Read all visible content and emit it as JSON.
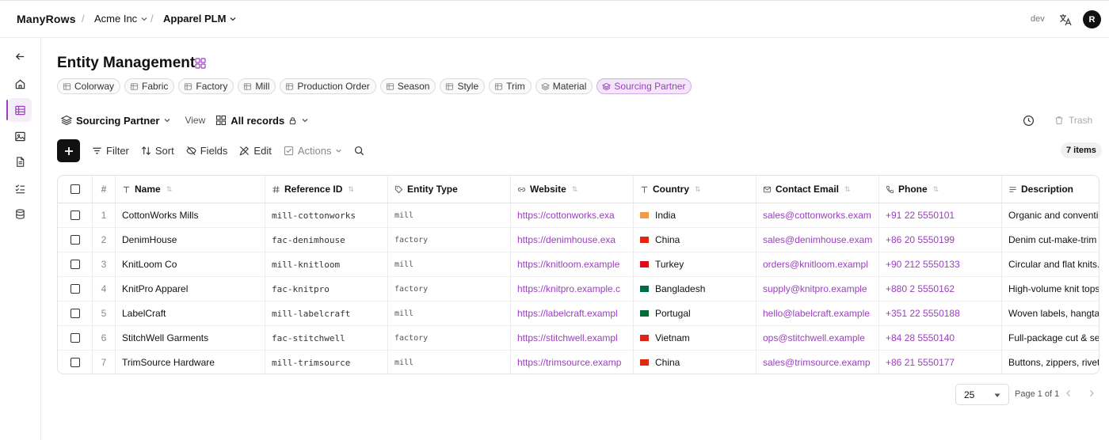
{
  "topbar": {
    "brand": "ManyRows",
    "breadcrumbs": [
      {
        "label": "Acme Inc",
        "bold": false
      },
      {
        "label": "Apparel PLM",
        "bold": true
      }
    ],
    "env": "dev",
    "avatar": "R"
  },
  "page": {
    "title": "Entity Management",
    "entity_tabs": [
      "Colorway",
      "Fabric",
      "Factory",
      "Mill",
      "Production Order",
      "Season",
      "Style",
      "Trim",
      "Material",
      "Sourcing Partner"
    ],
    "active_tab": "Sourcing Partner"
  },
  "viewbar": {
    "entity": "Sourcing Partner",
    "view_label": "View",
    "view_name": "All records",
    "trash": "Trash"
  },
  "toolbar": {
    "filter": "Filter",
    "sort": "Sort",
    "fields": "Fields",
    "edit": "Edit",
    "actions": "Actions",
    "count": "7 items"
  },
  "table": {
    "headers": {
      "num": "#",
      "name": "Name",
      "ref": "Reference ID",
      "type": "Entity Type",
      "web": "Website",
      "country": "Country",
      "email": "Contact Email",
      "phone": "Phone",
      "desc": "Description"
    },
    "rows": [
      {
        "n": "1",
        "name": "CottonWorks Mills",
        "ref": "mill-cottonworks",
        "type": "mill",
        "web": "https://cottonworks.exa",
        "country": "India",
        "flag": "in",
        "email": "sales@cottonworks.exam",
        "phone": "+91 22 5550101",
        "desc": "Organic and conventio"
      },
      {
        "n": "2",
        "name": "DenimHouse",
        "ref": "fac-denimhouse",
        "type": "factory",
        "web": "https://denimhouse.exa",
        "country": "China",
        "flag": "cn",
        "email": "sales@denimhouse.exam",
        "phone": "+86 20 5550199",
        "desc": "Denim cut-make-trim a"
      },
      {
        "n": "3",
        "name": "KnitLoom Co",
        "ref": "mill-knitloom",
        "type": "mill",
        "web": "https://knitloom.example",
        "country": "Turkey",
        "flag": "tr",
        "email": "orders@knitloom.exampl",
        "phone": "+90 212 5550133",
        "desc": "Circular and flat knits."
      },
      {
        "n": "4",
        "name": "KnitPro Apparel",
        "ref": "fac-knitpro",
        "type": "factory",
        "web": "https://knitpro.example.c",
        "country": "Bangladesh",
        "flag": "bd",
        "email": "supply@knitpro.example",
        "phone": "+880 2 5550162",
        "desc": "High-volume knit tops"
      },
      {
        "n": "5",
        "name": "LabelCraft",
        "ref": "mill-labelcraft",
        "type": "mill",
        "web": "https://labelcraft.exampl",
        "country": "Portugal",
        "flag": "pt",
        "email": "hello@labelcraft.example",
        "phone": "+351 22 5550188",
        "desc": "Woven labels, hangtag"
      },
      {
        "n": "6",
        "name": "StitchWell Garments",
        "ref": "fac-stitchwell",
        "type": "factory",
        "web": "https://stitchwell.exampl",
        "country": "Vietnam",
        "flag": "vn",
        "email": "ops@stitchwell.example",
        "phone": "+84 28 5550140",
        "desc": "Full-package cut & sew"
      },
      {
        "n": "7",
        "name": "TrimSource Hardware",
        "ref": "mill-trimsource",
        "type": "mill",
        "web": "https://trimsource.examp",
        "country": "China",
        "flag": "cn",
        "email": "sales@trimsource.examp",
        "phone": "+86 21 5550177",
        "desc": "Buttons, zippers, rivets"
      }
    ]
  },
  "pager": {
    "page_size": "25",
    "page_text": "Page 1 of 1"
  },
  "colors": {
    "accent": "#9b3fbf",
    "flags": {
      "in": "#f2994a",
      "cn": "#de2910",
      "tr": "#e30a17",
      "bd": "#006a4e",
      "pt": "#046a38",
      "vn": "#da251d"
    }
  }
}
